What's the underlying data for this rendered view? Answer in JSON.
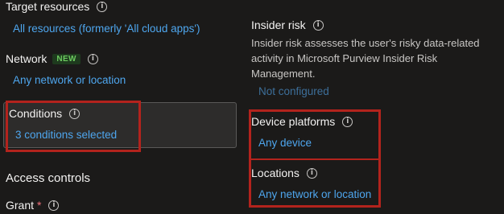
{
  "left": {
    "target_resources": {
      "label": "Target resources",
      "value": "All resources (formerly 'All cloud apps')"
    },
    "network": {
      "label": "Network",
      "badge": "NEW",
      "value": "Any network or location"
    },
    "conditions": {
      "label": "Conditions",
      "value": "3 conditions selected"
    },
    "access_controls": {
      "heading": "Access controls"
    },
    "grant": {
      "label": "Grant",
      "required_mark": "*"
    }
  },
  "right": {
    "insider_risk": {
      "label": "Insider risk",
      "description": "Insider risk assesses the user's risky data-related activity in Microsoft Purview Insider Risk Management.",
      "value": "Not configured"
    },
    "device_platforms": {
      "label": "Device platforms",
      "value": "Any device"
    },
    "locations": {
      "label": "Locations",
      "value": "Any network or location"
    }
  },
  "icons": {
    "info": "info-icon"
  },
  "colors": {
    "background": "#1b1a19",
    "link": "#4ea6ee",
    "highlight_box": "#b3231d",
    "new_badge": "#6ccb5f",
    "required": "#f1707b"
  }
}
